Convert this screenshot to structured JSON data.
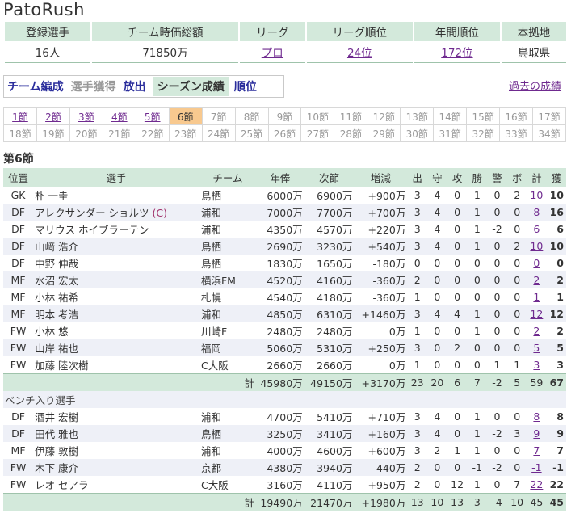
{
  "site_title": "PatoRush",
  "summary": {
    "headers": [
      "登録選手",
      "チーム時価総額",
      "リーグ",
      "リーグ順位",
      "年間順位",
      "本拠地"
    ],
    "registered": "16人",
    "market_value": "71850万",
    "league": "プロ",
    "league_rank": "24位",
    "annual_rank": "172位",
    "home": "鳥取県"
  },
  "menu": {
    "items": [
      {
        "label": "チーム編成",
        "state": "normal"
      },
      {
        "label": "選手獲得",
        "state": "disabled"
      },
      {
        "label": "放出",
        "state": "normal"
      },
      {
        "label": "シーズン成績",
        "state": "active"
      },
      {
        "label": "順位",
        "state": "normal"
      }
    ],
    "past_link": "過去の成績"
  },
  "rounds": {
    "row1": [
      "1節",
      "2節",
      "3節",
      "4節",
      "5節",
      "6節",
      "7節",
      "8節",
      "9節",
      "10節",
      "11節",
      "12節",
      "13節",
      "14節",
      "15節",
      "16節",
      "17節"
    ],
    "row2": [
      "18節",
      "19節",
      "20節",
      "21節",
      "22節",
      "23節",
      "24節",
      "25節",
      "26節",
      "27節",
      "28節",
      "29節",
      "30節",
      "31節",
      "32節",
      "33節",
      "34節"
    ],
    "current": "6節"
  },
  "section_title": "第6節",
  "table": {
    "headers": [
      "位置",
      "選手",
      "チーム",
      "年俸",
      "次節",
      "増減",
      "出",
      "守",
      "攻",
      "勝",
      "警",
      "ボ",
      "計",
      "獲"
    ],
    "starters": [
      [
        "GK",
        "朴 一圭",
        "鳥栖",
        "6000万",
        "6900万",
        "+900万",
        "3",
        "4",
        "0",
        "1",
        "0",
        "2",
        "10",
        "10"
      ],
      [
        "DF",
        "アレクサンダー ショルツ (C)",
        "浦和",
        "7000万",
        "7700万",
        "+700万",
        "3",
        "4",
        "0",
        "1",
        "0",
        "0",
        "8",
        "16"
      ],
      [
        "DF",
        "マリウス ホイブラーテン",
        "浦和",
        "4350万",
        "4570万",
        "+220万",
        "3",
        "4",
        "0",
        "1",
        "-2",
        "0",
        "6",
        "6"
      ],
      [
        "DF",
        "山﨑 浩介",
        "鳥栖",
        "2690万",
        "3230万",
        "+540万",
        "3",
        "4",
        "0",
        "1",
        "0",
        "2",
        "10",
        "10"
      ],
      [
        "DF",
        "中野 伸哉",
        "鳥栖",
        "1830万",
        "1650万",
        "-180万",
        "0",
        "0",
        "0",
        "0",
        "0",
        "0",
        "0",
        "0"
      ],
      [
        "MF",
        "水沼 宏太",
        "横浜FM",
        "4520万",
        "4160万",
        "-360万",
        "2",
        "0",
        "0",
        "0",
        "0",
        "0",
        "2",
        "2"
      ],
      [
        "MF",
        "小林 祐希",
        "札幌",
        "4540万",
        "4180万",
        "-360万",
        "1",
        "0",
        "0",
        "0",
        "0",
        "0",
        "1",
        "1"
      ],
      [
        "MF",
        "明本 考浩",
        "浦和",
        "4850万",
        "6310万",
        "+1460万",
        "3",
        "4",
        "4",
        "1",
        "0",
        "0",
        "12",
        "12"
      ],
      [
        "FW",
        "小林 悠",
        "川崎F",
        "2480万",
        "2480万",
        "0万",
        "1",
        "0",
        "0",
        "1",
        "0",
        "0",
        "2",
        "2"
      ],
      [
        "FW",
        "山岸 祐也",
        "福岡",
        "5060万",
        "5310万",
        "+250万",
        "3",
        "0",
        "2",
        "0",
        "0",
        "0",
        "5",
        "5"
      ],
      [
        "FW",
        "加藤 陸次樹",
        "C大阪",
        "2660万",
        "2660万",
        "0万",
        "1",
        "0",
        "0",
        "0",
        "1",
        "1",
        "3",
        "3"
      ]
    ],
    "starters_total": [
      "計",
      "45980万",
      "49150万",
      "+3170万",
      "23",
      "20",
      "6",
      "7",
      "-2",
      "5",
      "59",
      "67"
    ],
    "bench_label": "ベンチ入り選手",
    "bench": [
      [
        "DF",
        "酒井 宏樹",
        "浦和",
        "4700万",
        "5410万",
        "+710万",
        "3",
        "4",
        "0",
        "1",
        "0",
        "0",
        "8",
        "8"
      ],
      [
        "DF",
        "田代 雅也",
        "鳥栖",
        "3250万",
        "3410万",
        "+160万",
        "3",
        "4",
        "0",
        "1",
        "-2",
        "3",
        "9",
        "9"
      ],
      [
        "MF",
        "伊藤 敦樹",
        "浦和",
        "4000万",
        "4600万",
        "+600万",
        "3",
        "2",
        "1",
        "1",
        "0",
        "0",
        "7",
        "7"
      ],
      [
        "FW",
        "木下 康介",
        "京都",
        "4380万",
        "3940万",
        "-440万",
        "2",
        "0",
        "0",
        "-1",
        "-2",
        "0",
        "-1",
        "-1"
      ],
      [
        "FW",
        "レオ セアラ",
        "C大阪",
        "3160万",
        "4110万",
        "+950万",
        "2",
        "0",
        "12",
        "1",
        "0",
        "7",
        "22",
        "22"
      ]
    ],
    "bench_total": [
      "計",
      "19490万",
      "21470万",
      "+1980万",
      "13",
      "10",
      "13",
      "3",
      "-4",
      "10",
      "45",
      "45"
    ]
  },
  "colors": {
    "header_green": "#d3e9db",
    "link_purple": "#6f2a8f",
    "menu_blue": "#2a2d9c",
    "current_round": "#f8c98f",
    "row_alt": "#eef0f7"
  }
}
